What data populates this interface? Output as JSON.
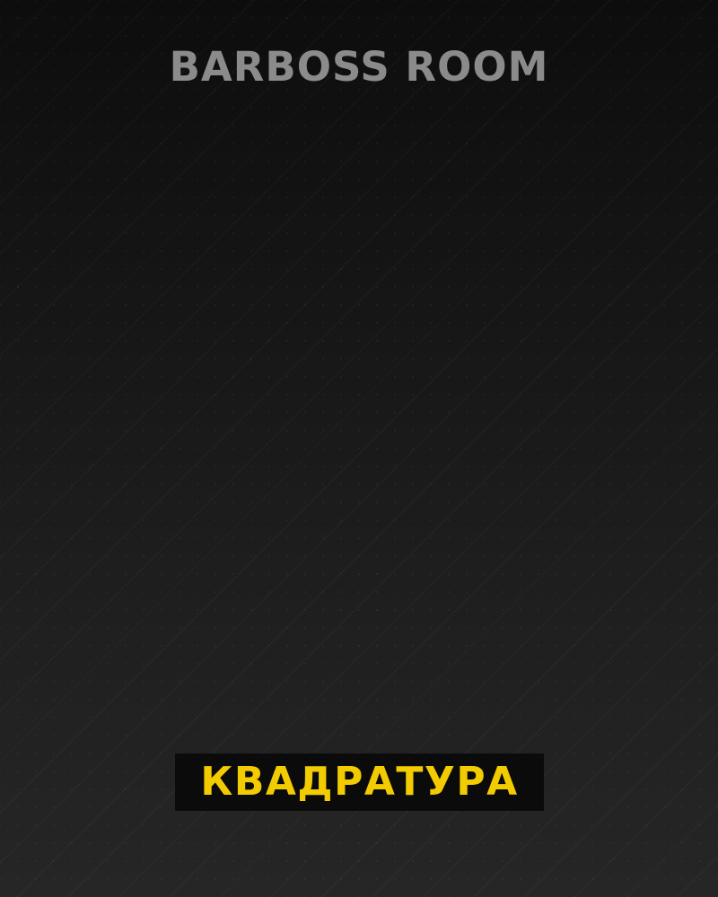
{
  "page": {
    "brand": "BARBOSS ROOM",
    "label": "КВАДРАТУРА"
  },
  "colors": {
    "background_top": "#0d0d0d",
    "background_bottom": "#262626",
    "brand_text": "#8b8b8b",
    "label_background": "#0b0b0b",
    "label_text": "#f2cc00"
  }
}
